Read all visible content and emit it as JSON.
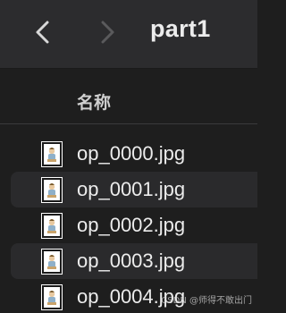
{
  "toolbar": {
    "back_icon": "chevron-left-icon",
    "forward_icon": "chevron-right-icon",
    "folder_title": "part1"
  },
  "column_header": {
    "name_label": "名称"
  },
  "files": [
    {
      "name": "op_0000.jpg",
      "icon": "image-thumbnail-icon",
      "highlighted": false
    },
    {
      "name": "op_0001.jpg",
      "icon": "image-thumbnail-icon",
      "highlighted": true
    },
    {
      "name": "op_0002.jpg",
      "icon": "image-thumbnail-icon",
      "highlighted": false
    },
    {
      "name": "op_0003.jpg",
      "icon": "image-thumbnail-icon",
      "highlighted": true
    },
    {
      "name": "op_0004.jpg",
      "icon": "image-thumbnail-icon",
      "highlighted": false
    }
  ],
  "watermark": "CSDN @师得不敢出门",
  "colors": {
    "toolbar_bg": "#2c2c2e",
    "window_bg": "#1e1e1e",
    "alt_row_bg": "#2a2a2c",
    "text": "#ececec",
    "nav_active": "#d8d8d8",
    "nav_disabled": "#5a5a5c"
  }
}
